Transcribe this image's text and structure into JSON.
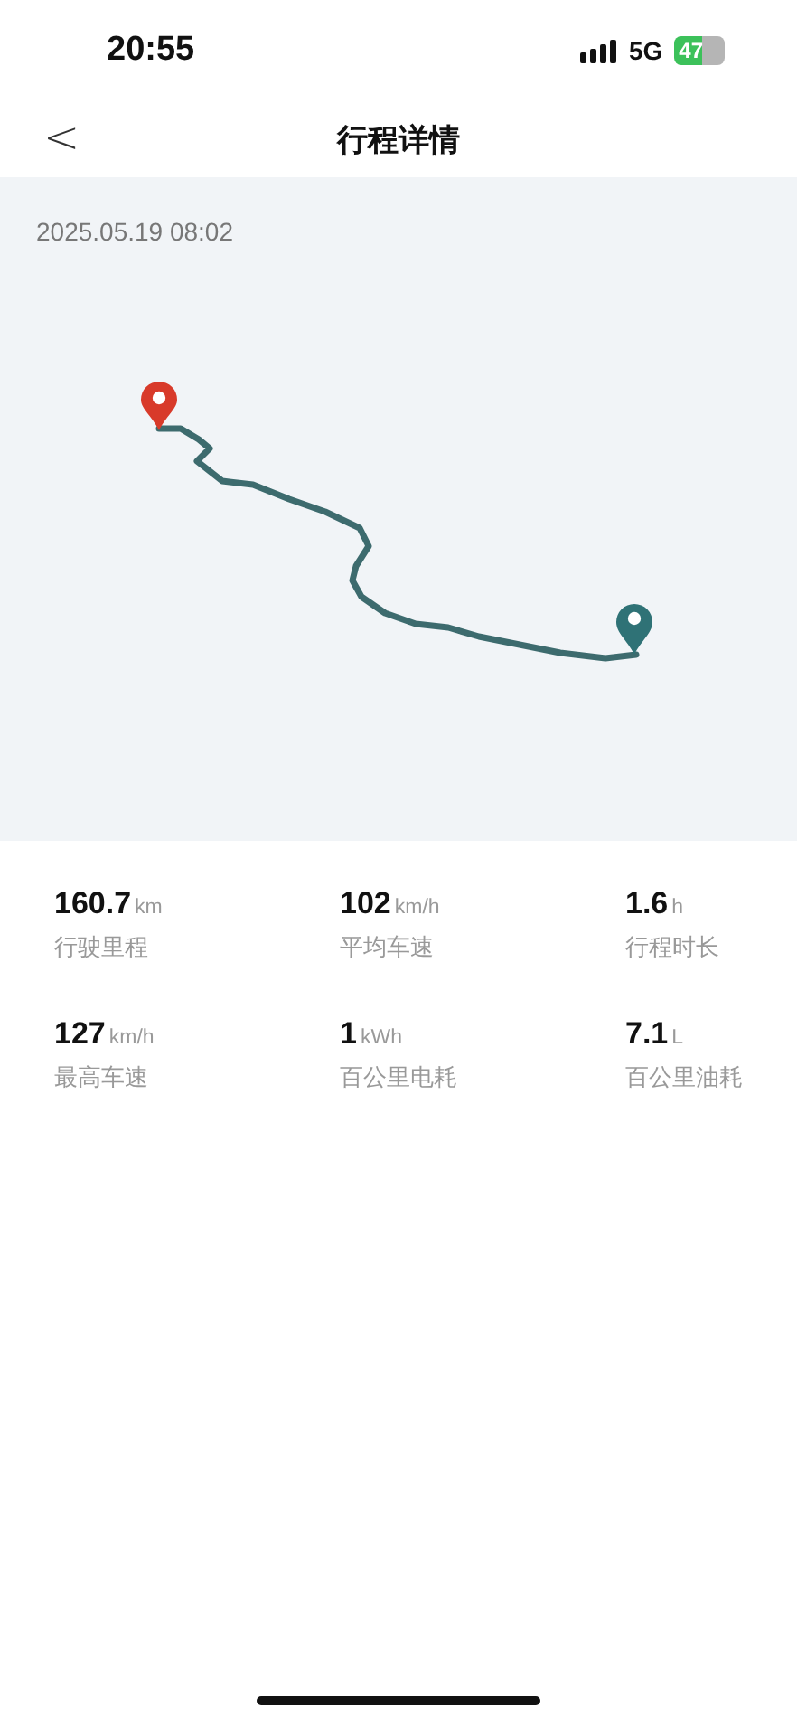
{
  "status_bar": {
    "time": "20:55",
    "network": "5G",
    "battery": "47"
  },
  "nav": {
    "back": "<",
    "title": "行程详情"
  },
  "trip": {
    "datetime": "2025.05.19 08:02"
  },
  "stats": [
    {
      "value": "160.7",
      "unit": "km",
      "label": "行驶里程"
    },
    {
      "value": "102",
      "unit": "km/h",
      "label": "平均车速"
    },
    {
      "value": "1.6",
      "unit": "h",
      "label": "行程时长"
    },
    {
      "value": "127",
      "unit": "km/h",
      "label": "最高车速"
    },
    {
      "value": "1",
      "unit": "kWh",
      "label": "百公里电耗"
    },
    {
      "value": "7.1",
      "unit": "L",
      "label": "百公里油耗"
    }
  ]
}
